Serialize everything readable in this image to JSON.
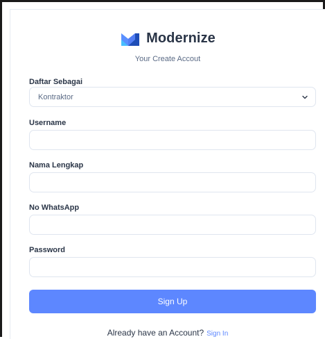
{
  "brand": {
    "name": "Modernize",
    "subtitle": "Your Create Accout"
  },
  "colors": {
    "primary": "#5d87ff",
    "text": "#2a3547",
    "muted": "#5a6a85",
    "border": "#dfe5ef"
  },
  "form": {
    "role": {
      "label": "Daftar Sebagai",
      "value": "Kontraktor"
    },
    "username": {
      "label": "Username",
      "value": "",
      "placeholder": ""
    },
    "full_name": {
      "label": "Nama Lengkap",
      "value": "",
      "placeholder": ""
    },
    "whatsapp": {
      "label": "No WhatsApp",
      "value": "",
      "placeholder": ""
    },
    "password": {
      "label": "Password",
      "value": "",
      "placeholder": ""
    },
    "submit_label": "Sign Up"
  },
  "footer": {
    "prompt": "Already have an Account?",
    "link_label": "Sign In"
  }
}
